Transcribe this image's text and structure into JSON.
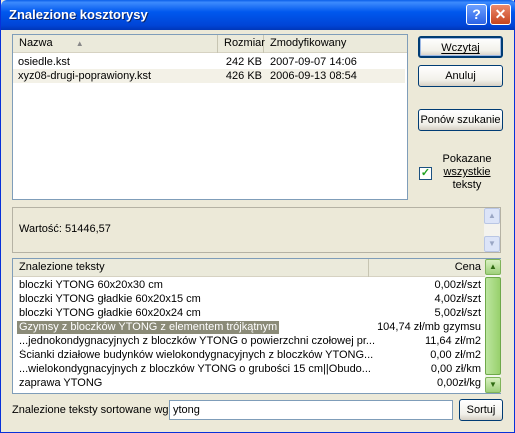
{
  "window": {
    "title": "Znalezione kosztorysy"
  },
  "file_list": {
    "columns": {
      "name": "Nazwa",
      "size": "Rozmiar",
      "modified": "Zmodyfikowany"
    },
    "rows": [
      {
        "name": "osiedle.kst",
        "size": "242 KB",
        "modified": "2007-09-07 14:06"
      },
      {
        "name": "xyz08-drugi-poprawiony.kst",
        "size": "426 KB",
        "modified": "2006-09-13 08:54"
      }
    ]
  },
  "buttons": {
    "load": "Wczytaj",
    "cancel": "Anuluj",
    "search_again": "Ponów szukanie",
    "sort": "Sortuj"
  },
  "show_all": {
    "label_line1": "Pokazane",
    "label_line2": "wszystkie",
    "label_line3": "teksty",
    "checked": true
  },
  "value_box": {
    "text": "Wartość: 51446,57"
  },
  "texts_list": {
    "columns": {
      "text": "Znalezione teksty",
      "price": "Cena"
    },
    "rows": [
      {
        "text": "bloczki YTONG 60x20x30 cm",
        "price": "0,00zł/szt"
      },
      {
        "text": "bloczki YTONG gładkie 60x20x15 cm",
        "price": "4,00zł/szt"
      },
      {
        "text": "bloczki YTONG gładkie 60x20x24 cm",
        "price": "5,00zł/szt"
      },
      {
        "text": "Gzymsy z bloczków YTONG z elementem trójkątnym",
        "price": "104,74 zł/mb gzymsu"
      },
      {
        "text": "...jednokondygnacyjnych z bloczków YTONG o powierzchni czołowej pr...",
        "price": "11,64 zł/m2"
      },
      {
        "text": "Ścianki działowe budynków wielokondygnacyjnych z bloczków YTONG...",
        "price": "0,00 zł/m2"
      },
      {
        "text": "...wielokondygnacyjnych z bloczków YTONG o grubości 15 cm||Obudo...",
        "price": "0,00 zł/km"
      },
      {
        "text": "zaprawa YTONG",
        "price": "0,00zł/kg"
      }
    ]
  },
  "sort_by": {
    "label": "Znalezione teksty sortowane wg:",
    "value": "ytong"
  }
}
